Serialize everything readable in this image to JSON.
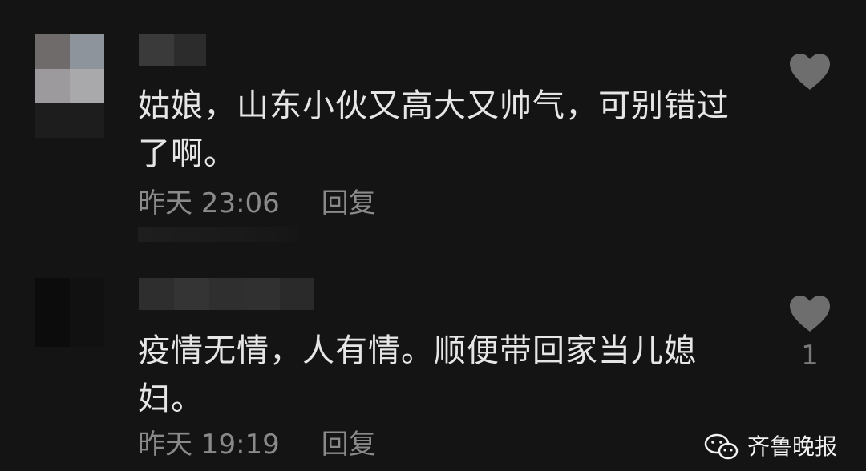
{
  "comments": [
    {
      "text": "姑娘，山东小伙又高大又帅气，可别错过了啊。",
      "time": "昨天 23:06",
      "reply_label": "回复",
      "like_count": ""
    },
    {
      "text": "疫情无情，人有情。顺便带回家当儿媳妇。",
      "time": "昨天 19:19",
      "reply_label": "回复",
      "like_count": "1"
    }
  ],
  "watermark": {
    "label": "齐鲁晚报",
    "icon": "wechat-icon"
  },
  "colors": {
    "background": "#141414",
    "text": "#e6e6e6",
    "meta": "#8a8a8a",
    "heart": "#6e6e6e"
  }
}
